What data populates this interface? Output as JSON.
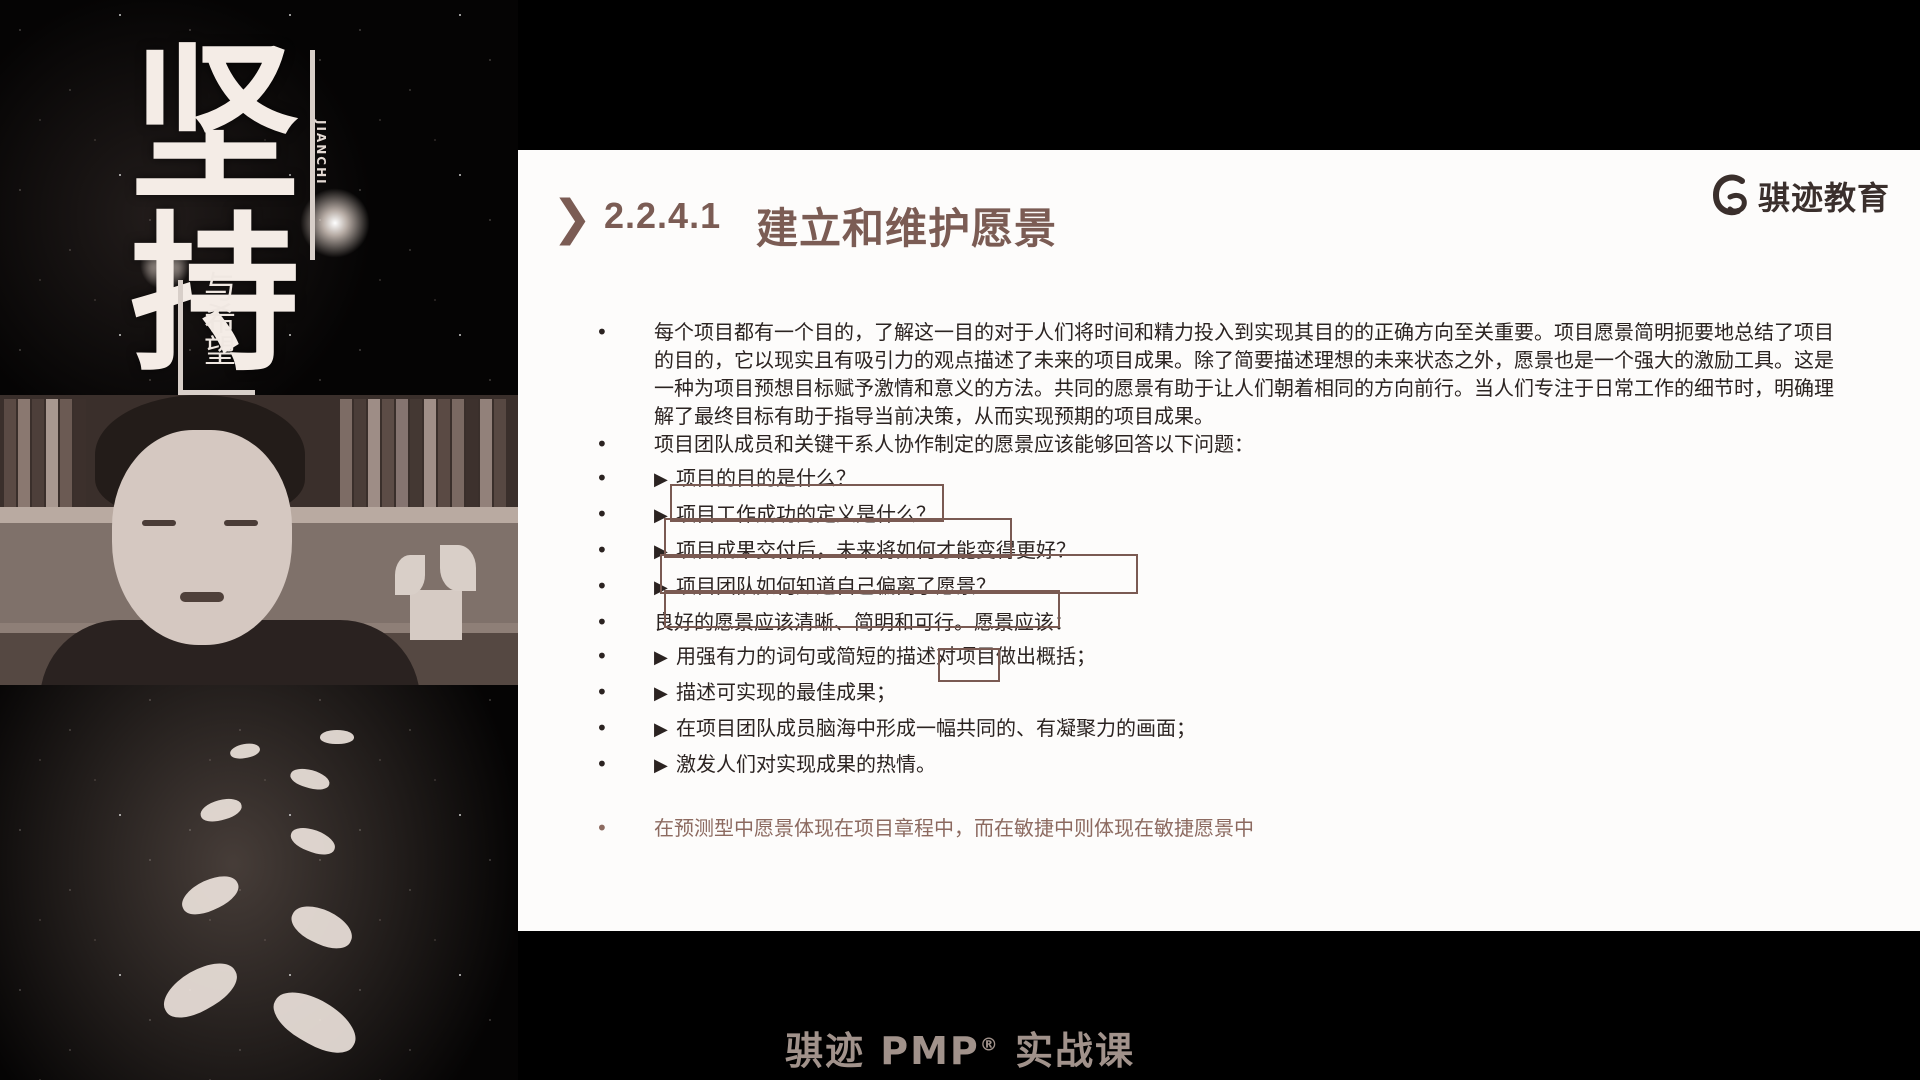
{
  "poster": {
    "main_calligraphy": "坚持",
    "latin": "JIANCHI",
    "sub_calligraphy": "与希望"
  },
  "slide": {
    "section_number": "2.2.4.1",
    "section_title": "建立和维护愿景",
    "logo_text": "骐迹教育",
    "items": [
      {
        "type": "bullet",
        "text": "每个项目都有一个目的，了解这一目的对于人们将时间和精力投入到实现其目的的正确方向至关重要。项目愿景简明扼要地总结了项目的目的，它以现实且有吸引力的观点描述了未来的项目成果。除了简要描述理想的未来状态之外，愿景也是一个强大的激励工具。这是一种为项目预想目标赋予激情和意义的方法。共同的愿景有助于让人们朝着相同的方向前行。当人们专注于日常工作的细节时，明确理解了最终目标有助于指导当前决策，从而实现预期的项目成果。"
      },
      {
        "type": "bullet",
        "text": "项目团队成员和关键干系人协作制定的愿景应该能够回答以下问题："
      },
      {
        "type": "sub",
        "text": "项目的目的是什么？"
      },
      {
        "type": "sub",
        "text": "项目工作成功的定义是什么？"
      },
      {
        "type": "sub",
        "text": "项目成果交付后，未来将如何才能变得更好？"
      },
      {
        "type": "sub",
        "text": "项目团队如何知道自己偏离了愿景？"
      },
      {
        "type": "bullet",
        "text": "良好的愿景应该清晰、简明和可行。愿景应该："
      },
      {
        "type": "sub",
        "text": "用强有力的词句或简短的描述对项目做出概括；"
      },
      {
        "type": "sub",
        "text": "描述可实现的最佳成果；"
      },
      {
        "type": "sub",
        "text": "在项目团队成员脑海中形成一幅共同的、有凝聚力的画面；"
      },
      {
        "type": "sub",
        "text": "激发人们对实现成果的热情。"
      }
    ],
    "note": "在预测型中愿景体现在项目章程中，而在敏捷中则体现在敏捷愿景中",
    "bullet_char": "•",
    "arrow_char": "▶"
  },
  "footer": {
    "prefix": "骐迹 PMP",
    "reg": "®",
    "suffix": " 实战课"
  },
  "colors": {
    "accent": "#7b5c54",
    "note": "#8c6a60"
  }
}
